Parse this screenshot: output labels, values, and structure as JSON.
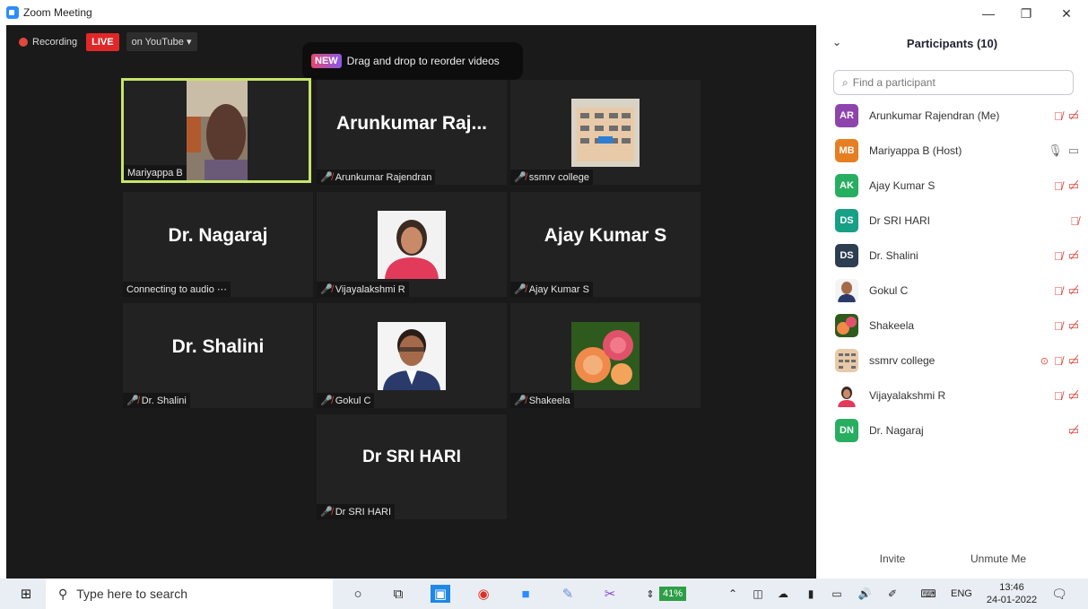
{
  "window": {
    "title": "Zoom Meeting"
  },
  "topbar": {
    "recording": "Recording",
    "live": "LIVE",
    "youtube": "on YouTube"
  },
  "tip": {
    "badge": "NEW",
    "text": "Drag and drop to reorder videos"
  },
  "tiles": [
    {
      "label": "Mariyappa B"
    },
    {
      "big": "Arunkumar  Raj...",
      "label": "Arunkumar Rajendran"
    },
    {
      "label": "ssmrv college"
    },
    {
      "big": "Dr. Nagaraj",
      "label": "Connecting to audio"
    },
    {
      "label": "Vijayalakshmi R"
    },
    {
      "big": "Ajay Kumar S",
      "label": "Ajay Kumar S"
    },
    {
      "big": "Dr. Shalini",
      "label": "Dr. Shalini"
    },
    {
      "label": "Gokul C"
    },
    {
      "label": "Shakeela"
    },
    {
      "big": "Dr SRI HARI",
      "label": "Dr SRI HARI"
    }
  ],
  "panel": {
    "title": "Participants (10)",
    "search_placeholder": "Find a participant",
    "participants": [
      {
        "initials": "AR",
        "name": "Arunkumar Rajendran (Me)",
        "color": "#8e44ad"
      },
      {
        "initials": "MB",
        "name": "Mariyappa B (Host)",
        "color": "#e67e22"
      },
      {
        "initials": "AK",
        "name": "Ajay Kumar S",
        "color": "#27ae60"
      },
      {
        "initials": "DS",
        "name": "Dr SRI HARI",
        "color": "#16a085"
      },
      {
        "initials": "DS",
        "name": "Dr. Shalini",
        "color": "#2c3e50"
      },
      {
        "initials": "",
        "name": "Gokul C",
        "color": "#6b4a3a"
      },
      {
        "initials": "",
        "name": "Shakeela",
        "color": "#e07a3a"
      },
      {
        "initials": "",
        "name": "ssmrv college",
        "color": "#9a8a7a"
      },
      {
        "initials": "",
        "name": "Vijayalakshmi R",
        "color": "#c44"
      },
      {
        "initials": "DN",
        "name": "Dr. Nagaraj",
        "color": "#27ae60"
      }
    ],
    "invite": "Invite",
    "unmute": "Unmute Me"
  },
  "taskbar": {
    "search_placeholder": "Type here to search",
    "battery": "41%",
    "lang": "ENG",
    "time": "13:46",
    "date": "24-01-2022"
  }
}
